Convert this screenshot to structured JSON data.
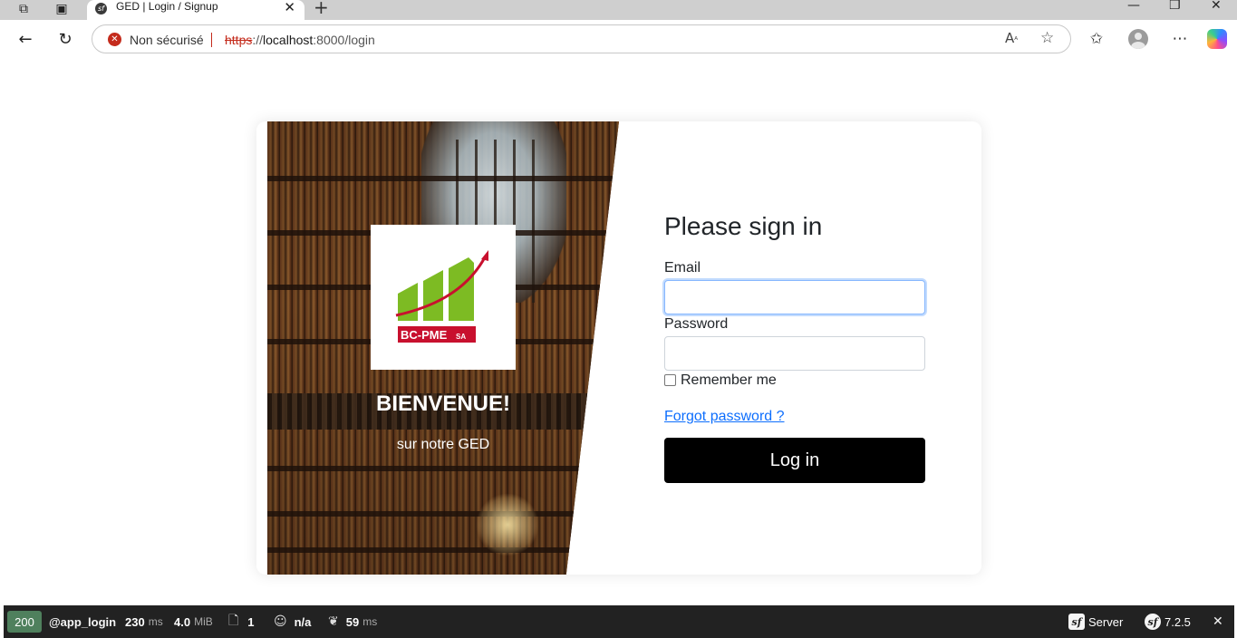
{
  "browser": {
    "tab_title": "GED | Login / Signup",
    "tab_favicon_letter": "sf",
    "security_label": "Non sécurisé",
    "url_scheme": "https",
    "url_separator": "://",
    "url_host": "localhost",
    "url_rest": ":8000/login",
    "icons": {
      "workspaces": "workspaces-icon",
      "tab_actions": "tab-actions-icon",
      "back": "back-arrow-icon",
      "reload": "reload-icon",
      "read_aloud": "read-aloud-icon",
      "favorite": "star-icon",
      "favorites_bar": "favorites-icon",
      "more": "more-icon"
    }
  },
  "login": {
    "logo_text": "BC-PME",
    "logo_suffix": "SA",
    "welcome_title": "BIENVENUE!",
    "welcome_subtitle": "sur notre GED",
    "form_title": "Please sign in",
    "email_label": "Email",
    "email_value": "",
    "password_label": "Password",
    "password_value": "",
    "remember_label": "Remember me",
    "remember_checked": false,
    "forgot_link": "Forgot password ?",
    "submit_label": "Log in",
    "colors": {
      "logo_green": "#7dbb23",
      "logo_red": "#c8102e",
      "button": "#000000",
      "link": "#0d6efd"
    }
  },
  "debug_toolbar": {
    "status_code": "200",
    "route": "@app_login",
    "time_value": "230",
    "time_unit": "ms",
    "memory_value": "4.0",
    "memory_unit": "MiB",
    "requests_count": "1",
    "user": "n/a",
    "twig_value": "59",
    "twig_unit": "ms",
    "server_label": "Server",
    "version": "7.2.5",
    "status_color": "#4f805d"
  }
}
